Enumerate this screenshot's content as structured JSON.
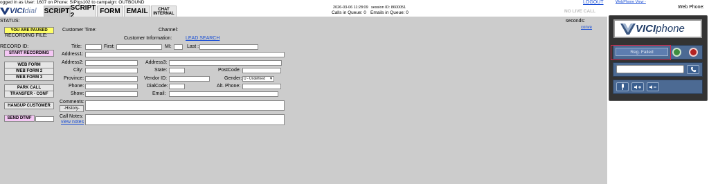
{
  "top": {
    "logged_in": "ogged in as User: 1607 on Phone: SIP/gs102  to campaign: OUTBOUND",
    "datetime": "2026-03-06 11:28:09",
    "session": "session ID: 8600051",
    "calls_in_queue": "Calls in Queue: 0",
    "emails_in_queue": "Emails in Queue: 0",
    "logout": "LOGOUT",
    "webphone_view": "WebPhone View -",
    "web_phone": "Web Phone:",
    "no_live_call": "NO LIVE CALL"
  },
  "logo": {
    "text1": "VICI",
    "text2": "dial"
  },
  "tabs": [
    "SCRIPT",
    "SCRIPT 2",
    "FORM",
    "EMAIL"
  ],
  "chat_tab": {
    "line1": "CHAT",
    "line2": "INTERNAL"
  },
  "left": {
    "status": "STATUS:",
    "paused": "YOU ARE PAUSED",
    "recording_file": "RECORDING FILE:",
    "record_id": "RECORD ID:",
    "start_recording": "START RECORDING",
    "web_form": "WEB FORM",
    "web_form_2": "WEB FORM 2",
    "web_form_3": "WEB FORM 3",
    "park_call": "PARK CALL",
    "transfer_conf": "TRANSFER - CONF",
    "hangup_customer": "HANGUP CUSTOMER",
    "send_dtmf": "SEND DTMF"
  },
  "form": {
    "customer_time": "Customer Time:",
    "channel": "Channel:",
    "customer_information": "Customer Information:",
    "lead_search": "LEAD SEARCH",
    "seconds": "seconds:",
    "conv": "conve",
    "title": "Title:",
    "first": "First:",
    "mi": "MI:",
    "last": "Last :",
    "address1": "Address1:",
    "address2": "Address2:",
    "address3": "Address3:",
    "city": "City:",
    "state": "State:",
    "postcode": "PostCode:",
    "province": "Province:",
    "vendor_id": "Vendor ID:",
    "gender": "Gender:",
    "gender_value": "U - Undefined",
    "phone": "Phone:",
    "dialcode": "DialCode:",
    "alt_phone": "Alt. Phone:",
    "show": "Show:",
    "email": "Email:",
    "comments": "Comments:",
    "history": "-History-",
    "call_notes": "Call Notes:",
    "view_notes": "view notes"
  },
  "phone": {
    "logo1": "VICI",
    "logo2": "phone",
    "reg_status": "Reg. Failed"
  },
  "colors": {
    "pane": "#cccccc",
    "phone_bar": "#4c6a93",
    "pause": "#ffff66",
    "pink": "#f4c7f4"
  }
}
